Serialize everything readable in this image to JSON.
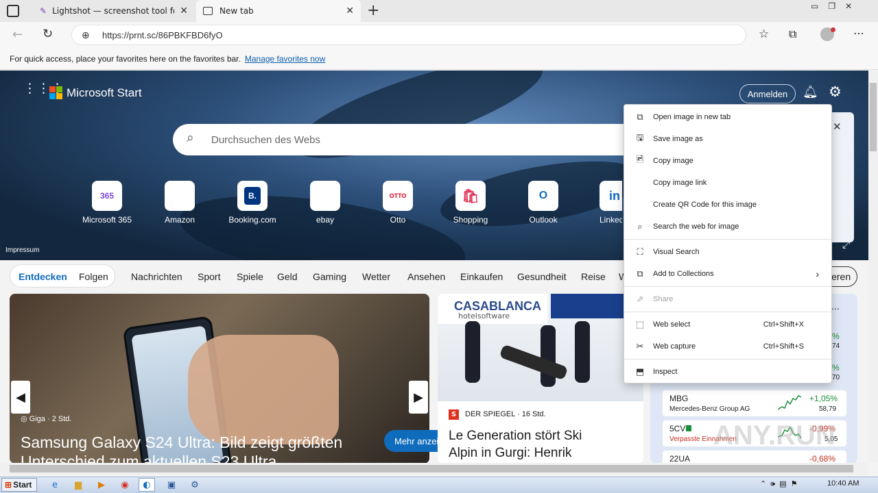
{
  "tabs": [
    {
      "title": "Lightshot — screenshot tool for M"
    },
    {
      "title": "New tab"
    }
  ],
  "address": {
    "url": "https://prnt.sc/86PBKFBD6fyO"
  },
  "favbar": {
    "text": "For quick access, place your favorites here on the favorites bar.",
    "link": "Manage favorites now"
  },
  "header": {
    "brand": "Microsoft Start",
    "signin": "Anmelden"
  },
  "search": {
    "placeholder": "Durchsuchen des Webs"
  },
  "quicklinks": [
    {
      "label": "Microsoft 365",
      "icon": "365"
    },
    {
      "label": "Amazon",
      "icon": "a"
    },
    {
      "label": "Booking.com",
      "icon": "B."
    },
    {
      "label": "ebay",
      "icon": "🛍"
    },
    {
      "label": "Otto",
      "icon": "OTTO"
    },
    {
      "label": "Shopping",
      "icon": "🛍"
    },
    {
      "label": "Outlook",
      "icon": "O"
    },
    {
      "label": "Linked",
      "icon": "in"
    }
  ],
  "impressum": "Impressum",
  "nav": {
    "explore": "Entdecken",
    "follow": "Folgen",
    "items": [
      "Nachrichten",
      "Sport",
      "Spiele",
      "Geld",
      "Gaming",
      "Wetter",
      "Ansehen",
      "Einkaufen",
      "Gesundheit",
      "Reise",
      "W"
    ],
    "right": "ieren"
  },
  "card1": {
    "source": "Giga",
    "age": "2 Std.",
    "headline": "Samsung Galaxy S24 Ultra: Bild zeigt größten",
    "headline2": "Unterschied zum aktuellen S23 Ultra",
    "more": "Mehr anzeigen"
  },
  "card2": {
    "source": "DER SPIEGEL",
    "age": "16 Std.",
    "headline": "Le Generation stört Ski",
    "headline2": "Alpin in Gurgi: Henrik",
    "banner": "CASABLANCA",
    "banner_sub": "hotelsoftware"
  },
  "stocks": [
    {
      "sym": "MBG",
      "name": "Mercedes-Benz Group AG",
      "change": "+1,05%",
      "price": "58,79"
    },
    {
      "sym": "5CV",
      "name": "Verpasste Einnahmen",
      "change": "-0,99%",
      "price": "5,05"
    },
    {
      "sym": "22UA",
      "name": "",
      "change": "-0,68%",
      "price": ""
    }
  ],
  "stock_partial": [
    {
      "change": "%",
      "price": "74"
    },
    {
      "change": "%",
      "price": "70"
    }
  ],
  "context_menu": [
    {
      "label": "Open image in new tab",
      "icon": "open-tab-icon",
      "shortcut": ""
    },
    {
      "label": "Save image as",
      "icon": "save-icon",
      "shortcut": ""
    },
    {
      "label": "Copy image",
      "icon": "copy-image-icon",
      "shortcut": ""
    },
    {
      "label": "Copy image link",
      "icon": "",
      "shortcut": ""
    },
    {
      "label": "Create QR Code for this image",
      "icon": "",
      "shortcut": ""
    },
    {
      "label": "Search the web for image",
      "icon": "search-image-icon",
      "shortcut": ""
    },
    {
      "label": "Visual Search",
      "icon": "visual-search-icon",
      "shortcut": ""
    },
    {
      "label": "Add to Collections",
      "icon": "collections-icon",
      "shortcut": ""
    },
    {
      "label": "Share",
      "icon": "share-icon",
      "shortcut": ""
    },
    {
      "label": "Web select",
      "icon": "web-select-icon",
      "shortcut": "Ctrl+Shift+X"
    },
    {
      "label": "Web capture",
      "icon": "web-capture-icon",
      "shortcut": "Ctrl+Shift+S"
    },
    {
      "label": "Inspect",
      "icon": "inspect-icon",
      "shortcut": ""
    }
  ],
  "taskbar": {
    "start": "Start",
    "clock": "10:40 AM"
  },
  "colors": {
    "accent": "#0f6cbd",
    "hero": "#2c4f79",
    "up": "#1a8f3a",
    "down": "#c42b1c"
  }
}
